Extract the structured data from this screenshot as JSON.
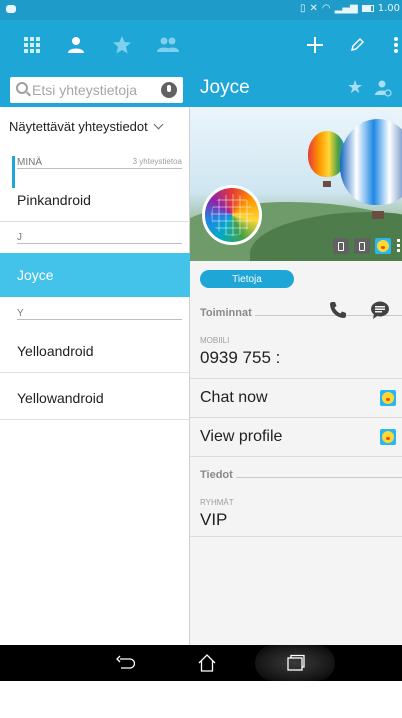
{
  "status_bar": {
    "right_text": "1.00",
    "colors": {
      "background": "#1f9bc9"
    }
  },
  "toolbar": {
    "icons": [
      "apps-grid-icon",
      "contacts-person-icon",
      "favorites-star-icon",
      "groups-icon",
      "add-icon",
      "edit-pencil-icon",
      "overflow-menu-icon"
    ],
    "accent_color": "#1ea6d6"
  },
  "search": {
    "placeholder": "Etsi yhteystietoja",
    "value": ""
  },
  "contacts": {
    "filter_label": "Näytettävät yhteystiedot",
    "me_section": {
      "label": "MINÄ",
      "count": "3 yhteystietoa"
    },
    "sections": [
      {
        "label": "J"
      },
      {
        "label": "Y"
      }
    ],
    "items": [
      {
        "name": "Pinkandroid"
      },
      {
        "name": "Joyce",
        "selected": true
      },
      {
        "name": "Yelloandroid"
      },
      {
        "name": "Yellowandroid"
      }
    ],
    "selected_color": "#43c2ea"
  },
  "detail": {
    "name": "Joyce",
    "tab_label": "Tietoja",
    "actions_section": "Toiminnat",
    "phone_caption": "MOBIILI",
    "phone_value": "0939 755 :",
    "chat_now": "Chat now",
    "view_profile": "View profile",
    "info_section": "Tiedot",
    "groups_caption": "RYHMÄT",
    "groups_value": "VIP"
  }
}
